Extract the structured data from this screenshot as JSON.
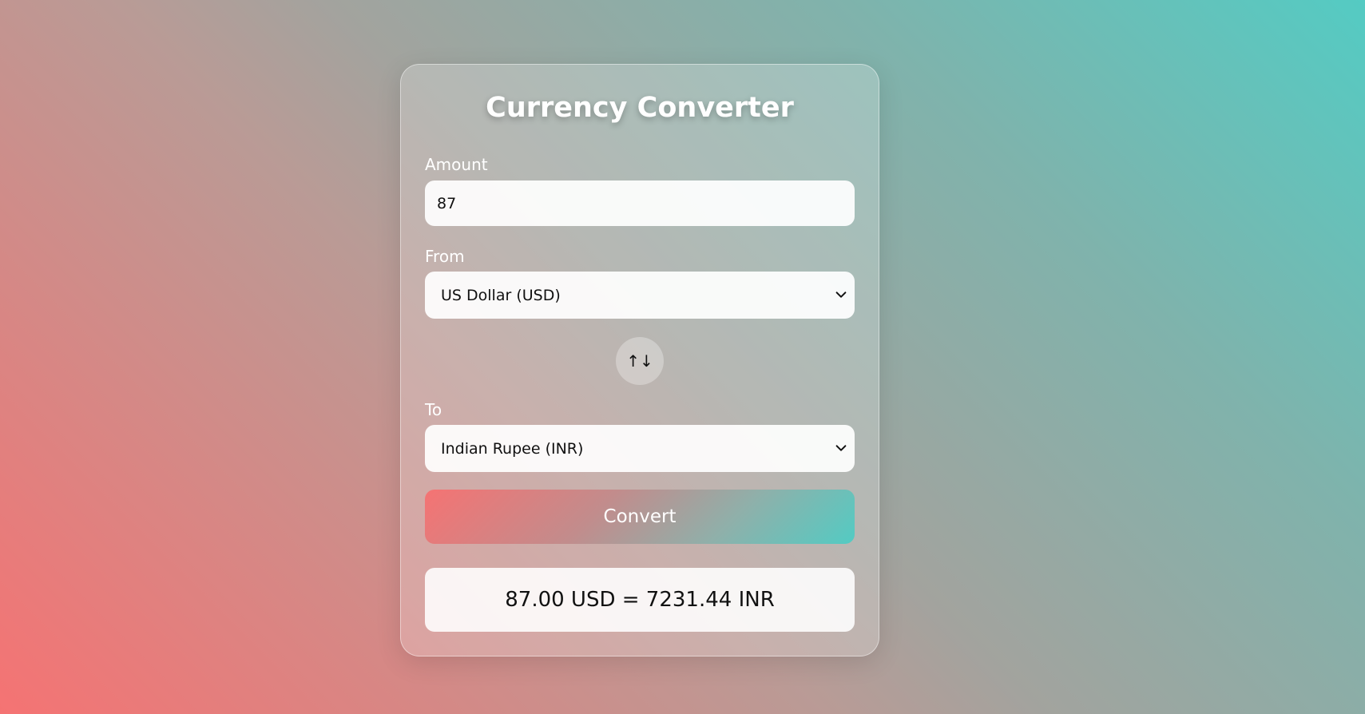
{
  "app": {
    "title": "Currency Converter"
  },
  "form": {
    "amount_label": "Amount",
    "amount_value": "87",
    "from_label": "From",
    "from_selected": "US Dollar (USD)",
    "to_label": "To",
    "to_selected": "Indian Rupee (INR)",
    "swap_symbol": "↑↓",
    "swap_icon": "swap-arrows-icon",
    "dropdown_icon": "chevron-down-icon",
    "convert_label": "Convert"
  },
  "result": {
    "text": "87.00 USD = 7231.44 INR"
  },
  "colors": {
    "gradient_start": "#f57373",
    "gradient_end": "#54cbc3"
  }
}
